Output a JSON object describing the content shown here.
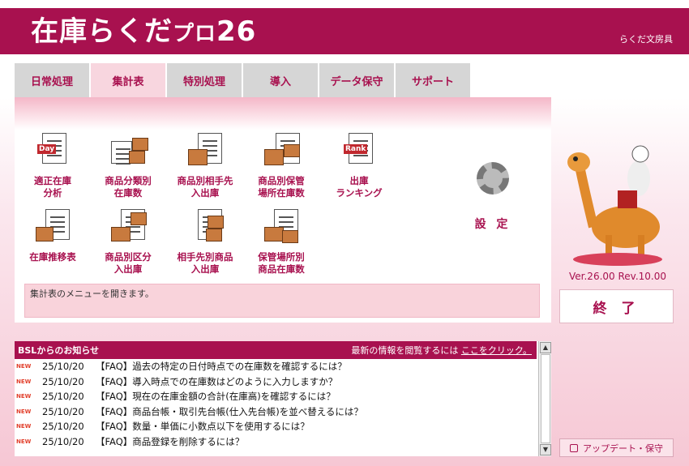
{
  "header": {
    "logo_main": "在庫らくだ",
    "logo_pro": "プロ",
    "logo_ver": "26",
    "company": "らくだ文房具"
  },
  "tabs": [
    {
      "label": "日常処理"
    },
    {
      "label": "集計表",
      "active": true
    },
    {
      "label": "特別処理"
    },
    {
      "label": "導入"
    },
    {
      "label": "データ保守"
    },
    {
      "label": "サポート"
    }
  ],
  "menu": {
    "items": [
      {
        "label": "適正在庫\n分析",
        "icon": "day-calendar-icon",
        "tag": "Day"
      },
      {
        "label": "商品分類別\n在庫数",
        "icon": "category-stock-icon"
      },
      {
        "label": "商品別相手先\n入出庫",
        "icon": "product-partner-icon"
      },
      {
        "label": "商品別保管\n場所在庫数",
        "icon": "storage-location-icon"
      },
      {
        "label": "出庫\nランキング",
        "icon": "ranking-icon",
        "tag": "Rank"
      },
      {
        "label": "在庫推移表",
        "icon": "stock-trend-icon"
      },
      {
        "label": "商品別区分\n入出庫",
        "icon": "product-division-icon"
      },
      {
        "label": "相手先別商品\n入出庫",
        "icon": "partner-product-icon"
      },
      {
        "label": "保管場所別\n商品在庫数",
        "icon": "location-product-icon"
      }
    ],
    "settings_label": "設 定",
    "status_text": "集計表のメニューを開きます。"
  },
  "side": {
    "version": "Ver.26.00 Rev.10.00",
    "exit_label": "終 了",
    "update_label": "アップデート・保守"
  },
  "news": {
    "title": "BSLからのお知らせ",
    "link_prefix": "最新の情報を閲覧するには",
    "link_text": "ここをクリック。",
    "badge": "NEW",
    "rows": [
      {
        "date": "25/10/20",
        "text": "【FAQ】過去の特定の日付時点での在庫数を確認するには？"
      },
      {
        "date": "25/10/20",
        "text": "【FAQ】導入時点での在庫数はどのように入力しますか？"
      },
      {
        "date": "25/10/20",
        "text": "【FAQ】現在の在庫金額の合計(在庫高)を確認するには？"
      },
      {
        "date": "25/10/20",
        "text": "【FAQ】商品台帳・取引先台帳(仕入先台帳)を並べ替えるには？"
      },
      {
        "date": "25/10/20",
        "text": "【FAQ】数量・単価に小数点以下を使用するには？"
      },
      {
        "date": "25/10/20",
        "text": "【FAQ】商品登録を削除するには？"
      }
    ]
  },
  "colors": {
    "brand": "#a8114f",
    "tab_active": "#f8d6df",
    "new_badge": "#e2412d"
  }
}
